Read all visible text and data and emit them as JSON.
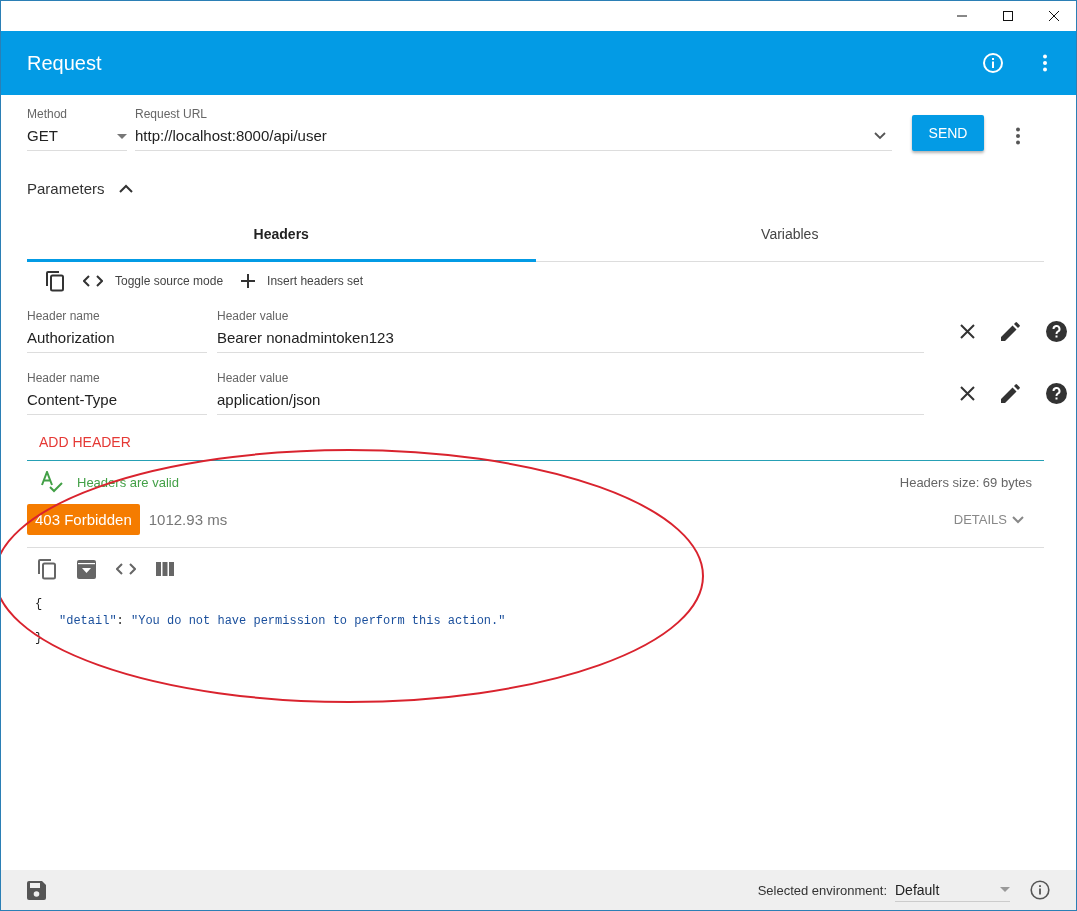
{
  "app_bar": {
    "title": "Request"
  },
  "request": {
    "method": {
      "label": "Method",
      "value": "GET"
    },
    "url": {
      "label": "Request URL",
      "value": "http://localhost:8000/api/user"
    },
    "send": "SEND"
  },
  "parameters": {
    "label": "Parameters",
    "expanded": true
  },
  "tabs": [
    {
      "label": "Headers",
      "selected": true
    },
    {
      "label": "Variables",
      "selected": false
    }
  ],
  "header_toolbar": [
    {
      "kind": "copy"
    },
    {
      "kind": "code",
      "label": "Toggle source mode"
    },
    {
      "kind": "add",
      "label": "Insert headers set"
    }
  ],
  "headers": [
    {
      "name_label": "Header name",
      "name": "Authorization",
      "value_label": "Header value",
      "value": "Bearer nonadmintoken123"
    },
    {
      "name_label": "Header name",
      "name": "Content-Type",
      "value_label": "Header value",
      "value": "application/json"
    }
  ],
  "add_header": "ADD HEADER",
  "validation": {
    "message": "Headers are valid",
    "size": "Headers size: 69 bytes"
  },
  "response": {
    "status": "403 Forbidden",
    "time": "1012.93 ms",
    "details": "DETAILS",
    "body": {
      "open": "{",
      "key": "\"detail\"",
      "separator": ": ",
      "value": "\"You do not have permission to perform this action.\"",
      "close": "}"
    }
  },
  "footer": {
    "environment_label": "Selected environment:",
    "environment": "Default"
  }
}
